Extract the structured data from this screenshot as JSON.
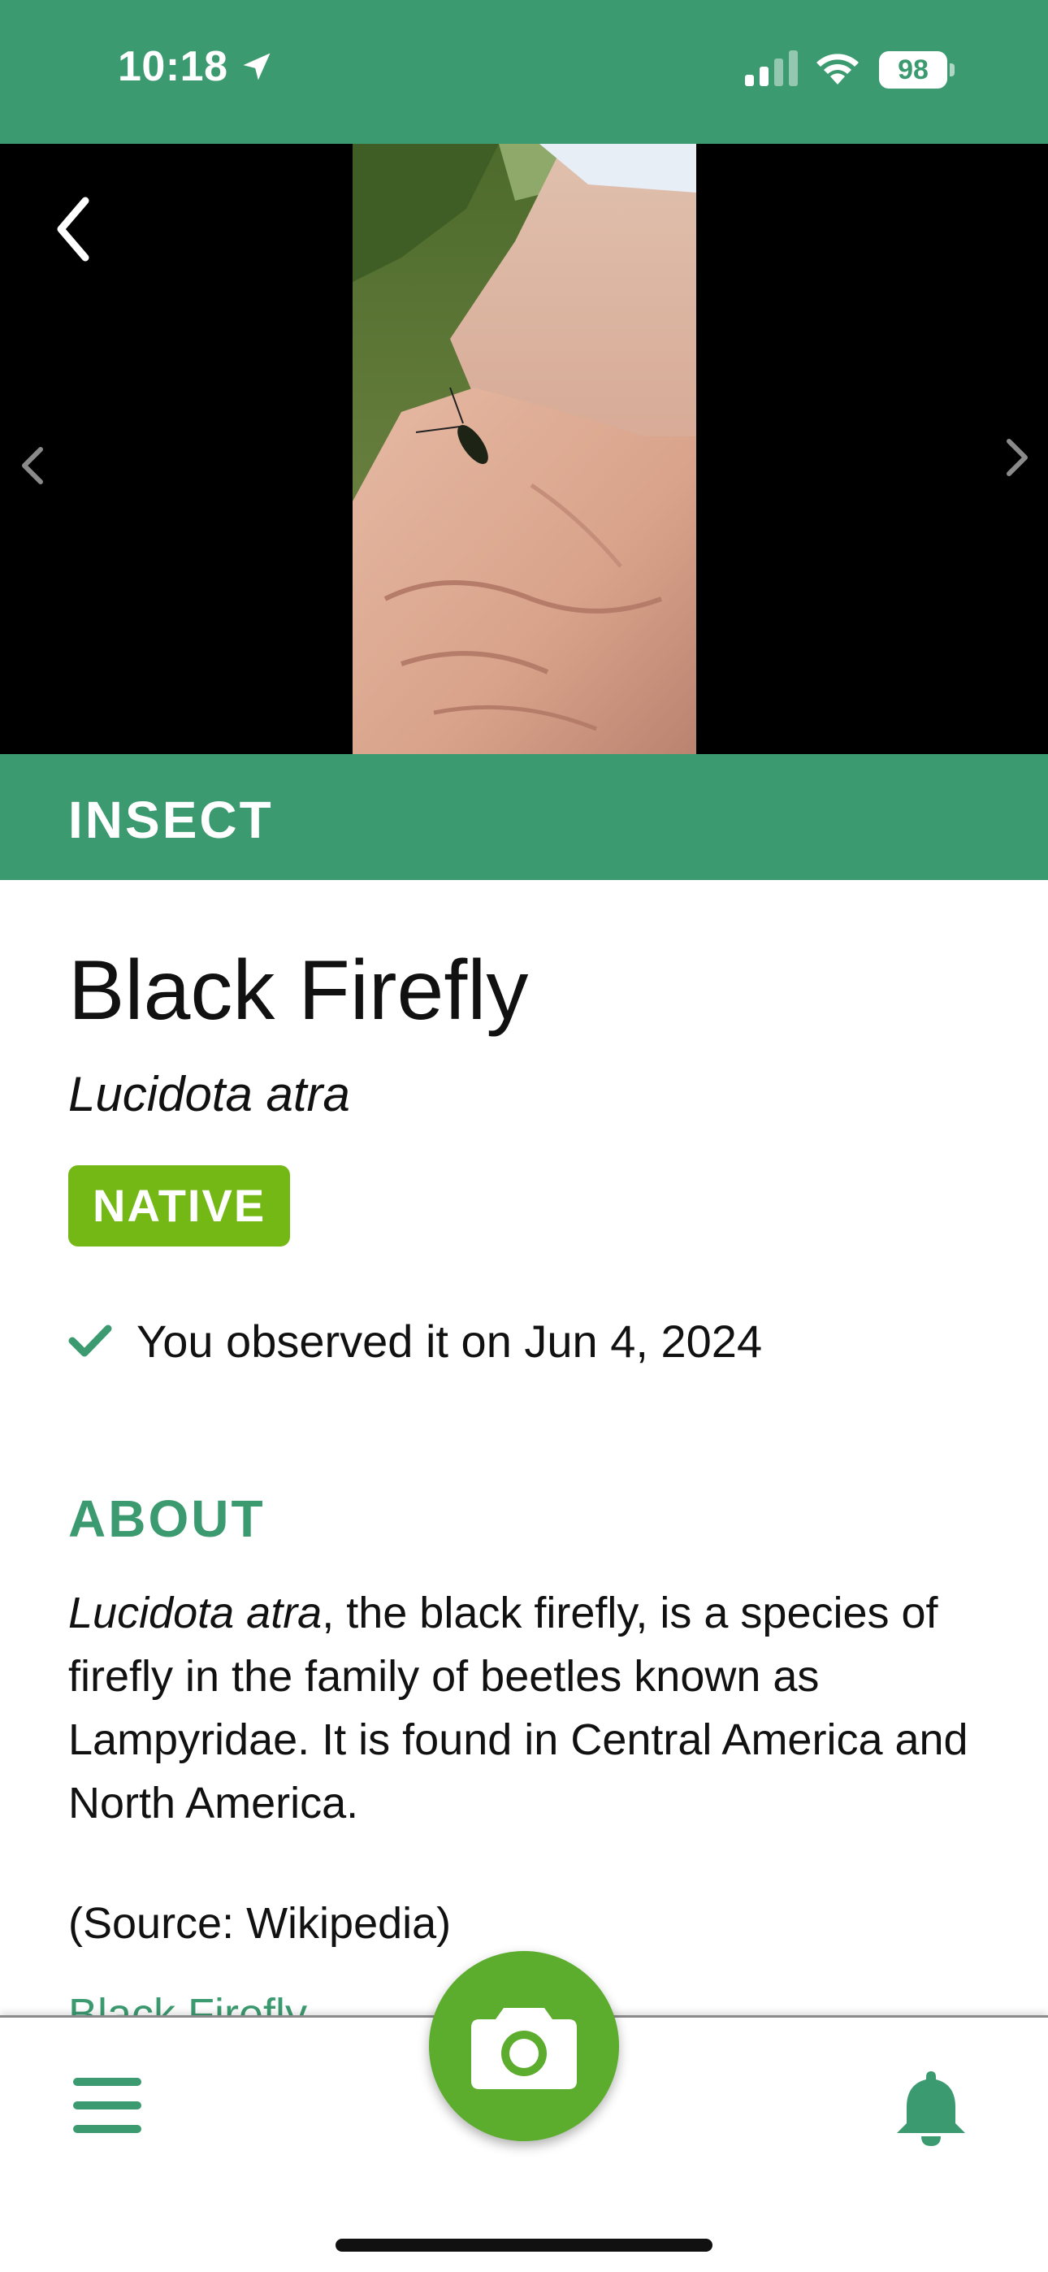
{
  "status_bar": {
    "time": "10:18",
    "battery": "98"
  },
  "nav": {
    "back_icon": "chevron-left-icon",
    "prev_icon": "chevron-left-icon",
    "next_icon": "chevron-right-icon"
  },
  "category": "INSECT",
  "species": {
    "common_name": "Black Firefly",
    "scientific_name": "Lucidota atra",
    "status_badge": "NATIVE",
    "observed_text": "You observed it on Jun 4, 2024"
  },
  "about": {
    "heading": "ABOUT",
    "intro_italic": "Lucidota atra",
    "body": ", the black firefly, is a species of firefly in the family of beetles known as Lampyridae. It is found in Central America and North America.",
    "source": "(Source: Wikipedia)",
    "link": "Black Firefly"
  },
  "bottom_nav": {
    "menu_icon": "hamburger-menu-icon",
    "camera_icon": "camera-icon",
    "bell_icon": "bell-icon"
  },
  "colors": {
    "brand_green": "#3c9a70",
    "native_green": "#74b816",
    "camera_green": "#5cac2d"
  }
}
